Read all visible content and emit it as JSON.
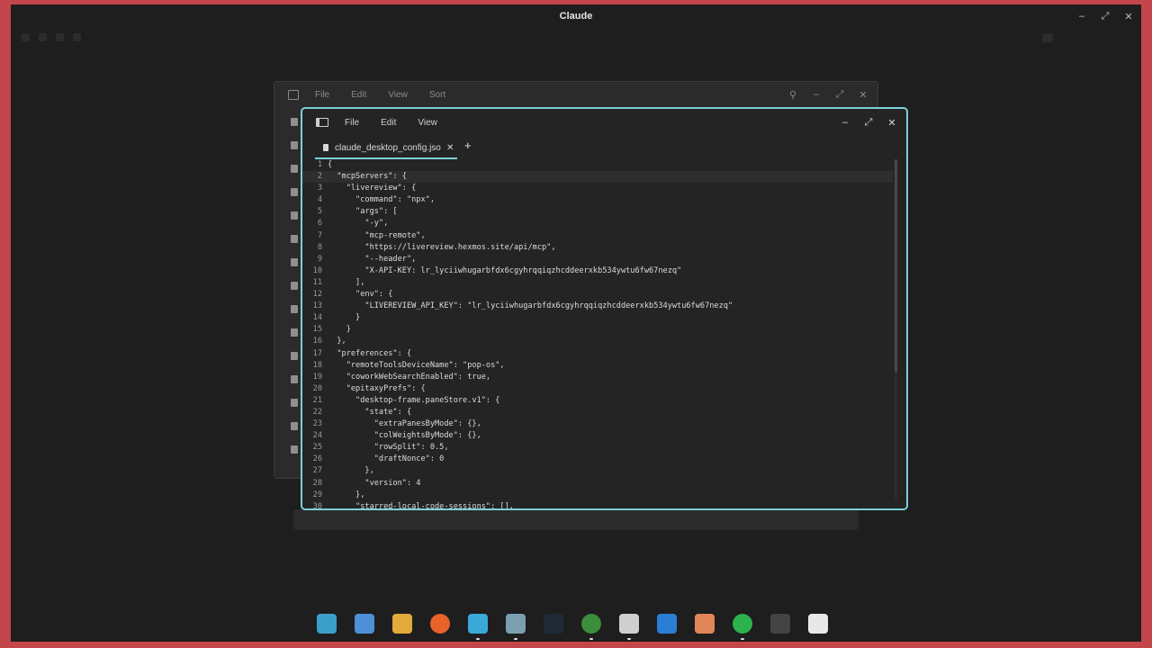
{
  "window": {
    "title": "Claude"
  },
  "file_manager": {
    "menu": [
      "File",
      "Edit",
      "View",
      "Sort"
    ]
  },
  "editor": {
    "menu": [
      "File",
      "Edit",
      "View"
    ],
    "tab_label": "claude_desktop_config.json",
    "lines": [
      "{",
      "  \"mcpServers\": {",
      "    \"livereview\": {",
      "      \"command\": \"npx\",",
      "      \"args\": [",
      "        \"-y\",",
      "        \"mcp-remote\",",
      "        \"https://livereview.hexmos.site/api/mcp\",",
      "        \"--header\",",
      "        \"X-API-KEY: lr_lyciiwhugarbfdx6cgyhrqqiqzhcddeerxkb534ywtu6fw67nezq\"",
      "      ],",
      "      \"env\": {",
      "        \"LIVEREVIEW_API_KEY\": \"lr_lyciiwhugarbfdx6cgyhrqqiqzhcddeerxkb534ywtu6fw67nezq\"",
      "      }",
      "    }",
      "  },",
      "  \"preferences\": {",
      "    \"remoteToolsDeviceName\": \"pop-os\",",
      "    \"coworkWebSearchEnabled\": true,",
      "    \"epitaxyPrefs\": {",
      "      \"desktop-frame.paneStore.v1\": {",
      "        \"state\": {",
      "          \"extraPanesByMode\": {},",
      "          \"colWeightsByMode\": {},",
      "          \"rowSplit\": 0.5,",
      "          \"draftNonce\": 0",
      "        },",
      "        \"version\": 4",
      "      },",
      "      \"starred-local-code-sessions\": [],"
    ]
  },
  "dock_icons": [
    "search-app-icon",
    "workspaces-icon",
    "app-grid-icon",
    "firefox-icon",
    "files-icon",
    "text-editor-icon",
    "terminal-icon",
    "chrome-icon",
    "package-icon",
    "arch-icon",
    "claude-icon",
    "sync-icon",
    "screenshot-icon",
    "display-icon"
  ],
  "colors": {
    "accent": "#7bd0d8",
    "background": "#1e1e1e",
    "border": "#c5464a"
  }
}
